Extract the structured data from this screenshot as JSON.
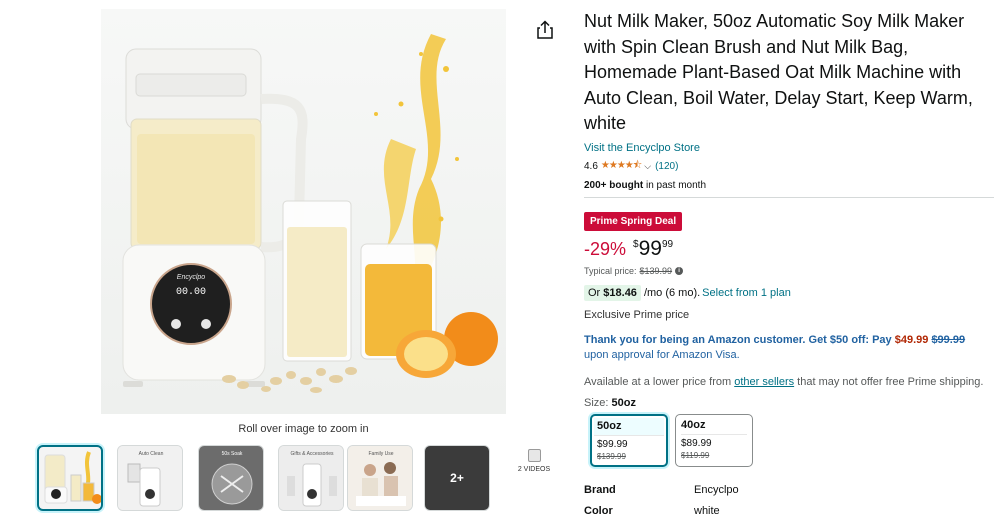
{
  "gallery": {
    "zoom_hint": "Roll over image to zoom in",
    "device_brand": "Encyclpo",
    "device_display": "00.00",
    "thumbnails": [
      {
        "icon": "product-thumbnail-icon"
      },
      {
        "icon": "auto-clean-thumbnail-icon"
      },
      {
        "icon": "no-soak-thumbnail-icon"
      },
      {
        "icon": "accessories-thumbnail-icon"
      },
      {
        "icon": "family-thumbnail-icon"
      },
      {
        "icon": "more-images-thumbnail-icon"
      }
    ],
    "thumbnail_captions": [
      "Auto Clean",
      "50s Soak",
      "Gifts & Accessories",
      "Family Use"
    ],
    "more_label": "2+",
    "videos_label": "2 VIDEOS"
  },
  "product": {
    "title": "Nut Milk Maker, 50oz Automatic Soy Milk Maker with Spin Clean Brush and Nut Milk Bag, Homemade Plant-Based Oat Milk Machine with Auto Clean, Boil Water, Delay Start, Keep Warm, white",
    "store_link": "Visit the Encyclpo Store",
    "rating": "4.6",
    "stars": "★★★★⯪",
    "rating_count": "(120)",
    "bought_bold": "200+ bought",
    "bought_rest": " in past month"
  },
  "pricing": {
    "deal_badge": "Prime Spring Deal",
    "discount": "-29%",
    "currency": "$",
    "whole": "99",
    "fraction": "99",
    "typical_label": "Typical price:",
    "typical_value": "$139.99",
    "or_label": "Or ",
    "monthly_amount": "$18.46",
    "monthly_rest": "/mo (6 mo).",
    "plan_link": "Select from 1 plan",
    "exclusive": "Exclusive Prime price"
  },
  "promo": {
    "lead": "Thank you for being an Amazon customer. Get $50 off: Pay ",
    "new_price": "$49.99",
    "old_price": "$99.99",
    "tail": "upon approval for Amazon Visa."
  },
  "lower_price": {
    "before": "Available at a lower price from ",
    "link": "other sellers",
    "after": " that may not offer free Prime shipping."
  },
  "size": {
    "label": "Size: ",
    "selected": "50oz",
    "options": [
      {
        "name": "50oz",
        "price": "$99.99",
        "was": "$139.99"
      },
      {
        "name": "40oz",
        "price": "$89.99",
        "was": "$119.99"
      }
    ]
  },
  "specs": [
    {
      "key": "Brand",
      "value": "Encyclpo"
    },
    {
      "key": "Color",
      "value": "white"
    }
  ],
  "colors": {
    "link": "#007185",
    "deal_red": "#cc0c39",
    "promo_blue": "#2162a1",
    "star": "#de7921",
    "juice": "#f2c43a",
    "orange": "#f28c1a"
  }
}
